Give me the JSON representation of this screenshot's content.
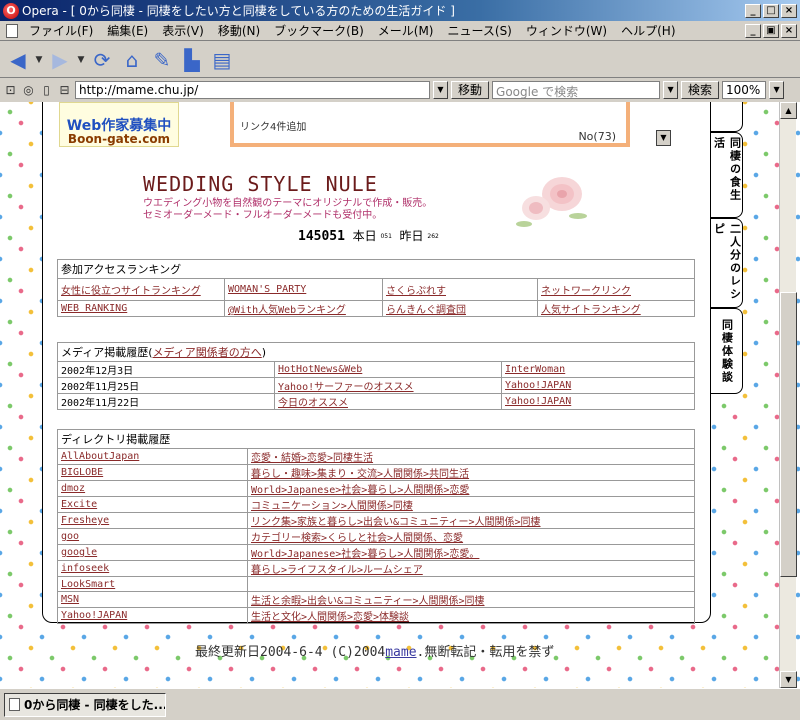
{
  "window": {
    "title": "Opera - [ 0から同棲 - 同棲をしたい方と同棲をしている方のための生活ガイド ]",
    "app_icon_letter": "O",
    "controls": [
      "_",
      "□",
      "×"
    ]
  },
  "menubar": {
    "items": [
      "ファイル(F)",
      "編集(E)",
      "表示(V)",
      "移動(N)",
      "ブックマーク(B)",
      "メール(M)",
      "ニュース(S)",
      "ウィンドウ(W)",
      "ヘルプ(H)"
    ],
    "mdi_controls": [
      "_",
      "▣",
      "×"
    ]
  },
  "navbar": {
    "icons": [
      "back-icon",
      "forward-icon",
      "reload-icon",
      "home-icon",
      "hotlist-icon",
      "print-icon",
      "page-icon"
    ]
  },
  "addressbar": {
    "url": "http://mame.chu.jp/",
    "go_label": "移動",
    "search_placeholder": "Google で検索",
    "search_label": "検索",
    "zoom": "100%"
  },
  "page": {
    "banner": {
      "line1": "Web作家募集中",
      "line2": "Boon-gate.com"
    },
    "news": {
      "text": "リンク4件追加",
      "number": "No(73)"
    },
    "site_title": "WEDDING STYLE NULE",
    "tagline_1": "ウエディング小物を自然観のテーマにオリジナルで作成・販売。",
    "tagline_2": "セミオーダーメード・フルオーダーメードも受付中。",
    "counter": {
      "total": "145051",
      "today_label": "本日",
      "today": "051",
      "yesterday_label": "昨日",
      "yesterday": "262"
    },
    "side_tabs": [
      "同棲の食生活",
      "二人分のレシピ",
      "同棲体験談"
    ],
    "ranking": {
      "heading": "参加アクセスランキング",
      "rows": [
        [
          "女性に役立つサイトランキング",
          "WOMAN'S PARTY",
          "さくらぷれす",
          "ネットワークリンク"
        ],
        [
          "WEB RANKING",
          "@With人気Webランキング",
          "らんきんぐ調査団",
          "人気サイトランキング"
        ]
      ]
    },
    "media": {
      "heading_prefix": "メディア掲載履歴(",
      "heading_link": "メディア関係者の方へ",
      "heading_suffix": ")",
      "rows": [
        [
          "2002年12月3日",
          "HotHotNews&Web",
          "InterWoman"
        ],
        [
          "2002年11月25日",
          "Yahoo!サーファーのオススメ",
          "Yahoo!JAPAN"
        ],
        [
          "2002年11月22日",
          "今日のオススメ",
          "Yahoo!JAPAN"
        ]
      ]
    },
    "directory": {
      "heading": "ディレクトリ掲載履歴",
      "rows": [
        [
          "AllAboutJapan",
          "恋愛・結婚>恋愛>同棲生活"
        ],
        [
          "BIGLOBE",
          "暮らし・趣味>集まり・交流>人間関係>共同生活"
        ],
        [
          "dmoz",
          "World>Japanese>社会>暮らし>人間関係>恋愛"
        ],
        [
          "Excite",
          "コミュニケーション>人間関係>同棲"
        ],
        [
          "Fresheye",
          "リンク集>家族と暮らし>出会い&コミュニティー>人間関係>同棲"
        ],
        [
          "goo",
          "カテゴリー検索>くらしと社会>人間関係、恋愛"
        ],
        [
          "google",
          "World>Japanese>社会>暮らし>人間関係>恋愛。"
        ],
        [
          "infoseek",
          "暮らし>ライフスタイル>ルームシェア"
        ],
        [
          "LookSmart",
          ""
        ],
        [
          "MSN",
          "生活と余暇>出会い&コミュニティー>人間関係>同棲"
        ],
        [
          "Yahoo!JAPAN",
          "生活と文化>人間関係>恋愛>体験談"
        ]
      ]
    },
    "footer": {
      "prefix": "最終更新日2004-6-4 (C)2004",
      "link": "mame",
      "suffix": ".無断転記・転用を禁ず"
    }
  },
  "taskbar": {
    "task_label": "0から同棲 - 同棲をした..."
  }
}
